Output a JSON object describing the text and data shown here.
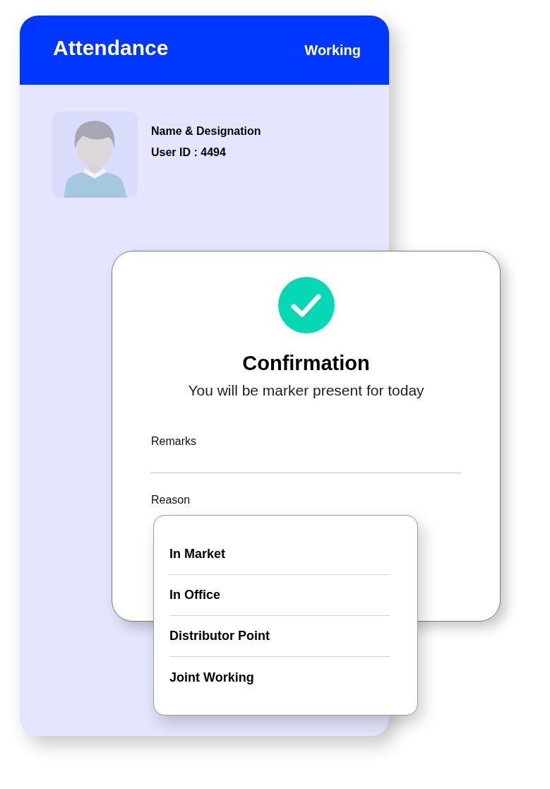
{
  "app": {
    "title": "Attendance",
    "status": "Working"
  },
  "profile": {
    "name": "Name & Designation",
    "user_id": "User ID : 4494"
  },
  "dialog": {
    "title": "Confirmation",
    "message": "You will be marker present for today",
    "fields": [
      {
        "label": "Remarks",
        "kind": "text"
      },
      {
        "label": "Reason",
        "kind": "select"
      }
    ]
  },
  "dropdown": {
    "options": [
      {
        "label": "In Market",
        "selected": false
      },
      {
        "label": "In Office",
        "selected": false
      },
      {
        "label": "Distributor Point",
        "selected": false
      },
      {
        "label": "Joint Working",
        "selected": false
      }
    ]
  }
}
